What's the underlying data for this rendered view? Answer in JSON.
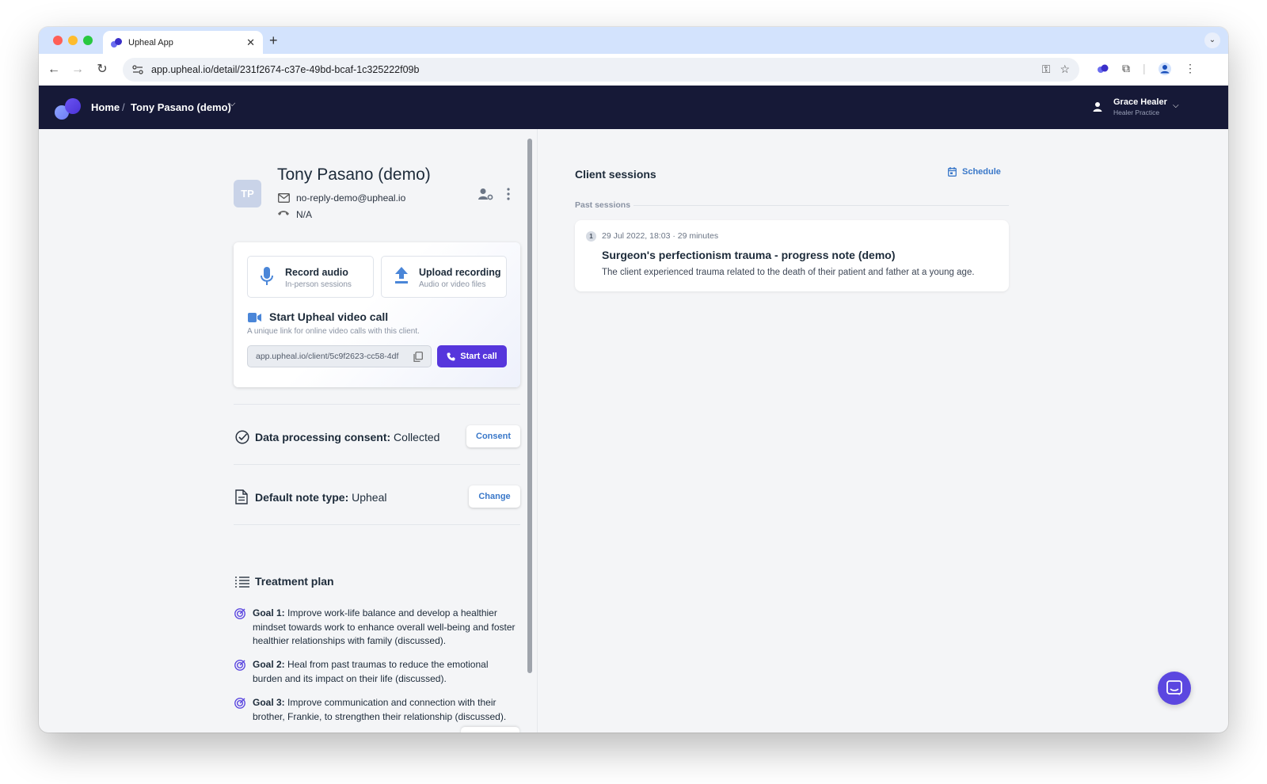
{
  "browser": {
    "tab_title": "Upheal App",
    "url": "app.upheal.io/detail/231f2674-c37e-49bd-bcaf-1c325222f09b"
  },
  "header": {
    "breadcrumb_home": "Home",
    "breadcrumb_separator": "/",
    "breadcrumb_client": "Tony Pasano (demo)",
    "user_name": "Grace Healer",
    "user_practice": "Healer Practice"
  },
  "client": {
    "initials": "TP",
    "name": "Tony Pasano (demo)",
    "email": "no-reply-demo@upheal.io",
    "phone": "N/A"
  },
  "actions": {
    "record_title": "Record audio",
    "record_sub": "In-person sessions",
    "upload_title": "Upload recording",
    "upload_sub": "Audio or video files",
    "video_title": "Start Upheal video call",
    "video_sub": "A unique link for online video calls with this client.",
    "video_link": "app.upheal.io/client/5c9f2623-cc58-4df",
    "start_call_label": "Start call"
  },
  "consent": {
    "label": "Data processing consent:",
    "value": "Collected",
    "button": "Consent"
  },
  "note_type": {
    "label": "Default note type:",
    "value": "Upheal",
    "button": "Change"
  },
  "treatment_plan": {
    "title": "Treatment plan",
    "goals": [
      {
        "label": "Goal 1:",
        "text": "Improve work-life balance and develop a healthier mindset towards work to enhance overall well-being and foster healthier relationships with family (discussed)."
      },
      {
        "label": "Goal 2:",
        "text": "Heal from past traumas to reduce the emotional burden and its impact on their life (discussed)."
      },
      {
        "label": "Goal 3:",
        "text": "Improve communication and connection with their brother, Frankie, to strengthen their relationship (discussed)."
      }
    ]
  },
  "sessions": {
    "title": "Client sessions",
    "schedule_label": "Schedule",
    "past_label": "Past sessions",
    "items": [
      {
        "number": "1",
        "meta": "29 Jul 2022, 18:03 · 29 minutes",
        "title": "Surgeon's perfectionism trauma - progress note (demo)",
        "description": "The client experienced trauma related to the death of their patient and father at a young age."
      }
    ]
  },
  "colors": {
    "accent": "#5636dc",
    "header_bg": "#161937",
    "link_blue": "#3a78c9"
  },
  "icons": [
    "mic-icon",
    "upload-icon",
    "video-camera-icon",
    "copy-icon",
    "phone-icon",
    "check-circle-icon",
    "document-icon",
    "list-icon",
    "target-icon",
    "calendar-icon",
    "chat-icon"
  ]
}
